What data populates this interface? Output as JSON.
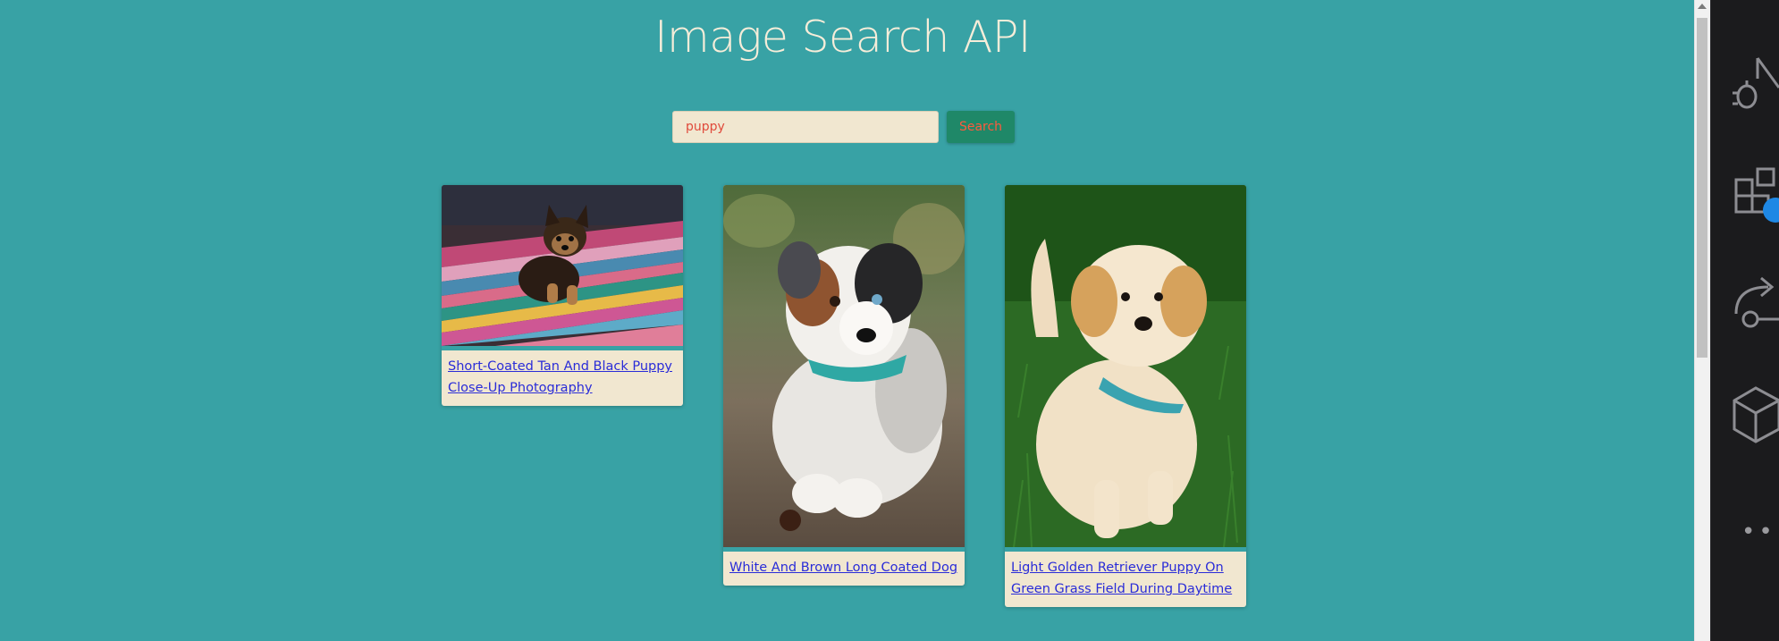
{
  "header": {
    "title": "Image Search API"
  },
  "search": {
    "query": "puppy",
    "button_label": "Search"
  },
  "results": [
    {
      "caption": "Short-Coated Tan And Black Puppy Close-Up Photography",
      "subject": "yorkshire-terrier-puppy-on-striped-rug"
    },
    {
      "caption": "White And Brown Long Coated Dog",
      "subject": "australian-shepherd-puppy-lying-on-ground"
    },
    {
      "caption": "Light Golden Retriever Puppy On Green Grass Field During Daytime",
      "subject": "golden-retriever-puppy-sitting-on-grass"
    }
  ],
  "side_panel": {
    "icons": [
      "run-debug-icon",
      "extensions-icon",
      "remote-explorer-icon",
      "box-icon",
      "more-icon"
    ]
  },
  "colors": {
    "background": "#38a2a5",
    "card_bg": "#f1e7d0",
    "button_bg": "#1f8868",
    "accent_text": "#e04a3b",
    "link": "#2a2cd8"
  }
}
